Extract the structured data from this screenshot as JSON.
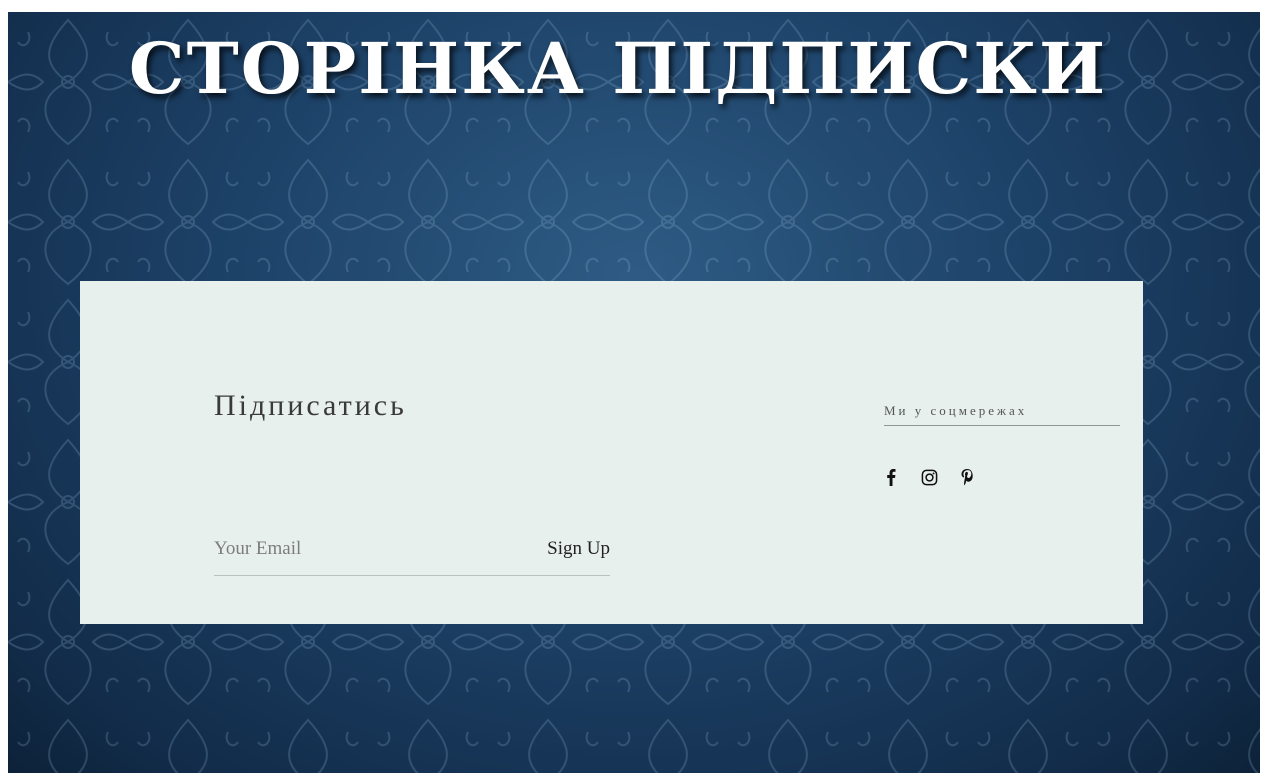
{
  "slide": {
    "title": "СТОРІНКА ПІДПИСКИ"
  },
  "subscribe": {
    "heading": "Підписатись",
    "email_placeholder": "Your Email",
    "signup_label": "Sign Up"
  },
  "social": {
    "heading": "Ми у соцмережах",
    "icons": [
      "facebook-icon",
      "instagram-icon",
      "pinterest-icon"
    ]
  },
  "colors": {
    "background": "#1d4268",
    "panel": "#e8f0ed",
    "title": "#ffffff"
  }
}
